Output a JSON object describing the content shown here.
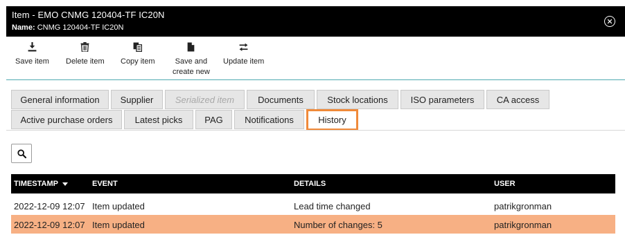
{
  "window": {
    "title": "Item - EMO CNMG 120404-TF IC20N",
    "name_label": "Name:",
    "name_value": "CNMG 120404-TF IC20N"
  },
  "toolbar": {
    "save": "Save item",
    "delete": "Delete item",
    "copy": "Copy item",
    "save_new_1": "Save and",
    "save_new_2": "create new",
    "update": "Update item"
  },
  "tabs": {
    "row1": [
      "General information",
      "Supplier",
      "Serialized item",
      "Documents",
      "Stock locations",
      "ISO parameters",
      "CA access"
    ],
    "row2": [
      "Active purchase orders",
      "Latest picks",
      "PAG",
      "Notifications",
      "History"
    ],
    "active": "History",
    "disabled": "Serialized item"
  },
  "history": {
    "columns": [
      "TIMESTAMP",
      "EVENT",
      "DETAILS",
      "USER"
    ],
    "rows": [
      [
        "2022-12-09 12:07",
        "Item updated",
        "Lead time changed",
        "patrikgronman"
      ],
      [
        "2022-12-09 12:07",
        "Item updated",
        "Number of changes: 5",
        "patrikgronman"
      ]
    ],
    "selected_row": 1,
    "selected_color": "#f7b084"
  },
  "colors": {
    "accent": "#f08a3a",
    "toolbar_line": "#4ea9b0"
  },
  "icons": {
    "close": "close-circle-icon",
    "save": "download-icon",
    "delete": "trash-icon",
    "copy": "copy-icon",
    "save_new": "file-icon",
    "update": "swap-arrows-icon",
    "search": "search-icon",
    "sort": "sort-down-icon"
  }
}
